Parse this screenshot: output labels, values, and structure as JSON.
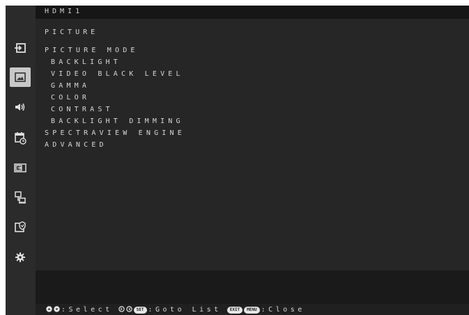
{
  "osd": {
    "input_label": "HDMI1",
    "section_title": "PICTURE",
    "menu_items": [
      {
        "label": "PICTURE MODE",
        "level": 0
      },
      {
        "label": "BACKLIGHT",
        "level": 1
      },
      {
        "label": "VIDEO BLACK LEVEL",
        "level": 1
      },
      {
        "label": "GAMMA",
        "level": 1
      },
      {
        "label": "COLOR",
        "level": 1
      },
      {
        "label": "CONTRAST",
        "level": 1
      },
      {
        "label": "BACKLIGHT DIMMING",
        "level": 1
      },
      {
        "label": "SPECTRAVIEW ENGINE",
        "level": 0
      },
      {
        "label": "ADVANCED",
        "level": 0
      }
    ],
    "sidebar_icons": [
      {
        "name": "input-icon",
        "selected": false
      },
      {
        "name": "picture-icon",
        "selected": true
      },
      {
        "name": "audio-icon",
        "selected": false
      },
      {
        "name": "schedule-icon",
        "selected": false
      },
      {
        "name": "multi-input-icon",
        "selected": false
      },
      {
        "name": "network-icon",
        "selected": false
      },
      {
        "name": "protect-icon",
        "selected": false
      },
      {
        "name": "settings-icon",
        "selected": false
      }
    ],
    "footer": {
      "select_label": ":Select",
      "set_key": "SET",
      "goto_label": ":Goto List",
      "exit_key": "EXIT",
      "menu_key": "MENU",
      "close_label": ":Close"
    },
    "colors": {
      "background": "#232323",
      "sidebar": "#2b2b2b",
      "selected_icon_bg": "#c8c8c8",
      "text": "#d8d8d8"
    }
  }
}
